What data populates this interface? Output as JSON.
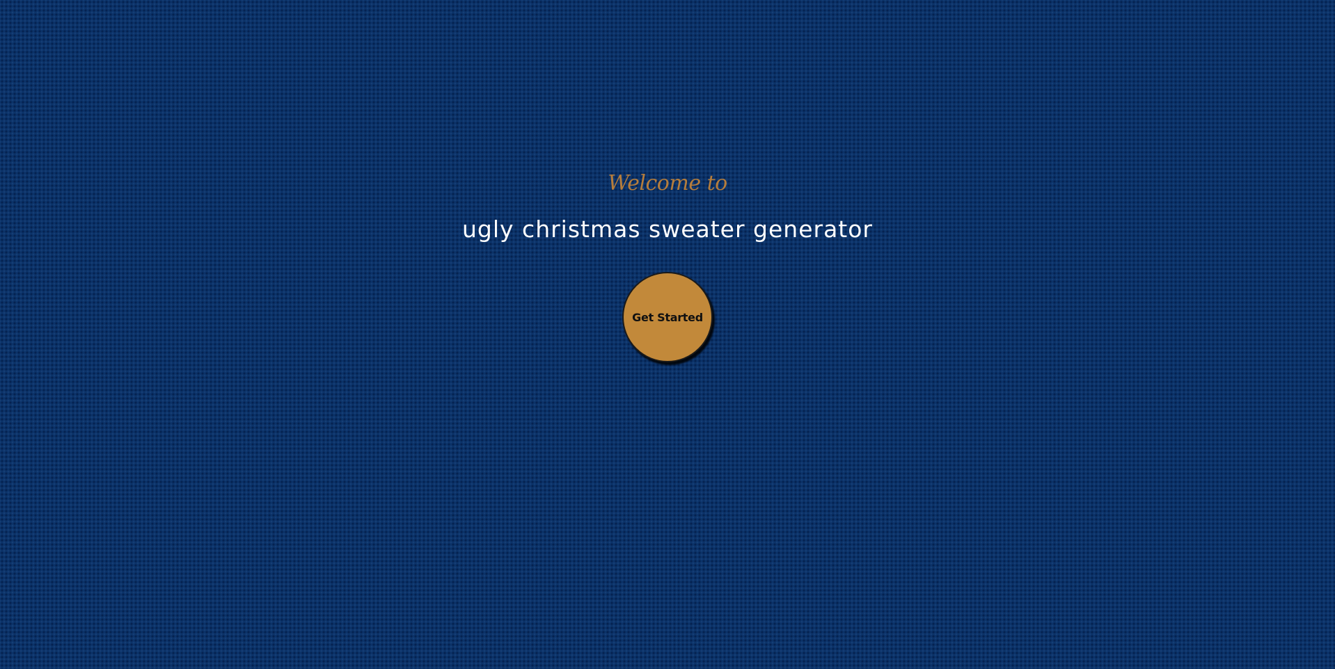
{
  "hero": {
    "welcome_text": "Welcome to",
    "title": "ugly christmas sweater generator",
    "cta_label": "Get Started"
  },
  "colors": {
    "background": "#0b3268",
    "accent": "#c2893a",
    "welcome_text": "#b57d3c",
    "title_text": "#ffffff"
  }
}
